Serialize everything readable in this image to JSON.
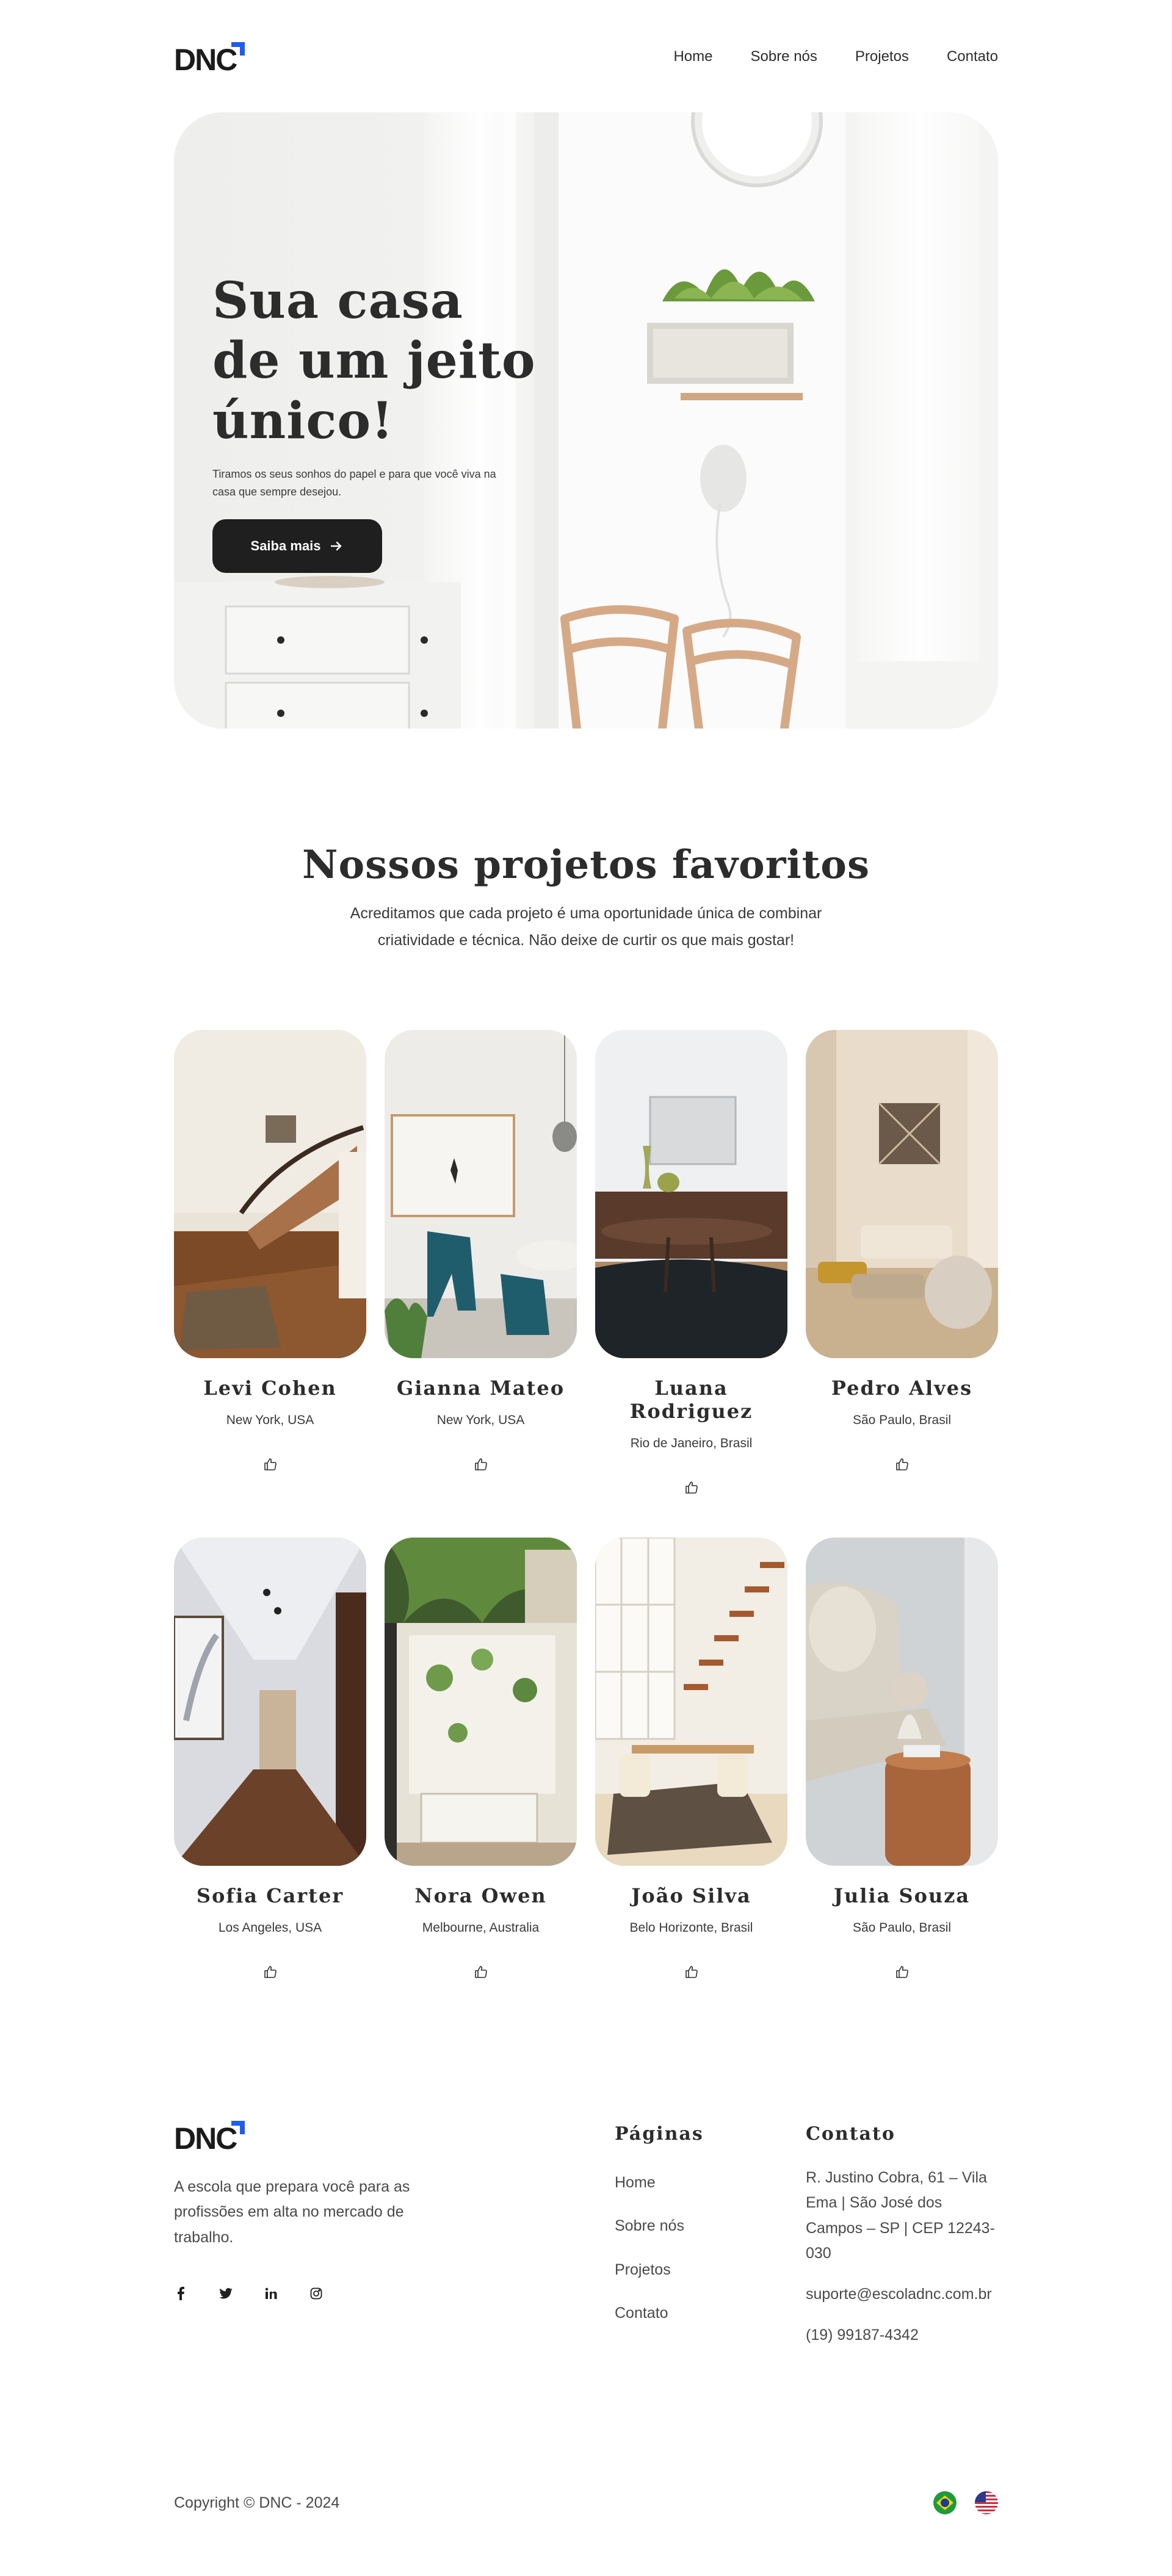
{
  "brand": {
    "name": "DNC",
    "accent": "#1f5cf0"
  },
  "nav": {
    "items": [
      "Home",
      "Sobre nós",
      "Projetos",
      "Contato"
    ]
  },
  "hero": {
    "title": "Sua casa de um jeito único!",
    "subtitle": "Tiramos os seus sonhos do papel e para que você viva na casa que sempre desejou.",
    "button": "Saiba mais",
    "button_icon": "arrow-right-icon"
  },
  "projects": {
    "title": "Nossos projetos favoritos",
    "subtitle_line1": "Acreditamos que cada projeto é uma oportunidade única de combinar",
    "subtitle_line2": "criatividade e técnica. Não deixe de curtir os que mais gostar!",
    "items": [
      {
        "name": "Levi Cohen",
        "location": "New York, USA"
      },
      {
        "name": "Gianna Mateo",
        "location": "New York, USA"
      },
      {
        "name": "Luana Rodriguez",
        "location": "Rio de Janeiro, Brasil"
      },
      {
        "name": "Pedro Alves",
        "location": "São Paulo, Brasil"
      },
      {
        "name": "Sofia Carter",
        "location": "Los Angeles, USA"
      },
      {
        "name": "Nora Owen",
        "location": "Melbourne, Australia"
      },
      {
        "name": "João Silva",
        "location": "Belo Horizonte, Brasil"
      },
      {
        "name": "Julia Souza",
        "location": "São Paulo, Brasil"
      }
    ],
    "like_icon": "thumbs-up-icon"
  },
  "footer": {
    "description": "A escola que prepara você para as profissões em alta no mercado de trabalho.",
    "socials": [
      "facebook-icon",
      "twitter-icon",
      "linkedin-icon",
      "instagram-icon"
    ],
    "pages_title": "Páginas",
    "pages": [
      "Home",
      "Sobre nós",
      "Projetos",
      "Contato"
    ],
    "contact_title": "Contato",
    "address": "R. Justino Cobra, 61 – Vila Ema | São José dos Campos – SP | CEP 12243-030",
    "email": "suporte@escoladnc.com.br",
    "phone": "(19) 99187-4342",
    "copyright": "Copyright © DNC - 2024",
    "languages": [
      "brazil-flag-icon",
      "usa-flag-icon"
    ]
  }
}
